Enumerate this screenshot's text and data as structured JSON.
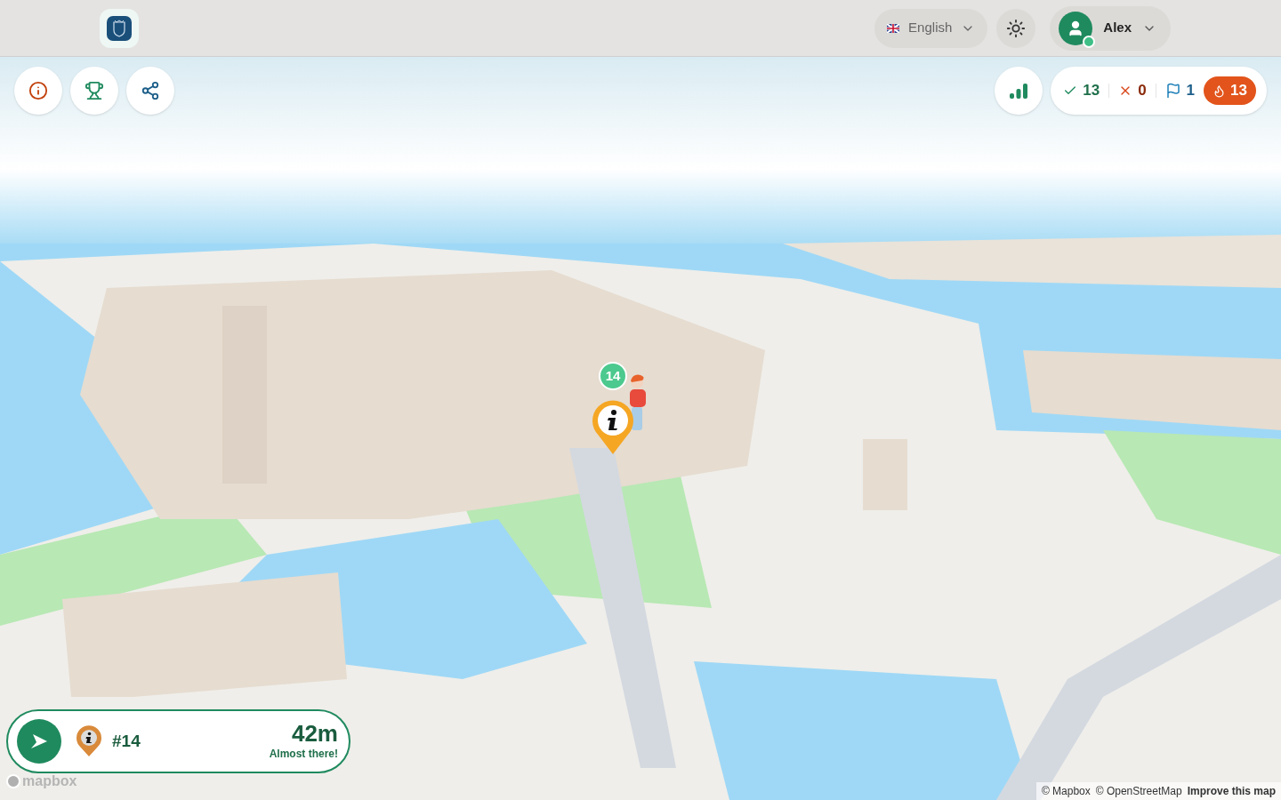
{
  "header": {
    "language": "English",
    "user": {
      "name": "Alex",
      "online": true
    }
  },
  "stats": {
    "correct": "13",
    "wrong": "0",
    "flags": "1",
    "streak": "13"
  },
  "map": {
    "marker_number": "14"
  },
  "navigation_card": {
    "target": "#14",
    "distance": "42m",
    "message": "Almost there!"
  },
  "attribution": {
    "logo": "mapbox",
    "links": [
      "© Mapbox",
      "© OpenStreetMap",
      "Improve this map"
    ]
  }
}
